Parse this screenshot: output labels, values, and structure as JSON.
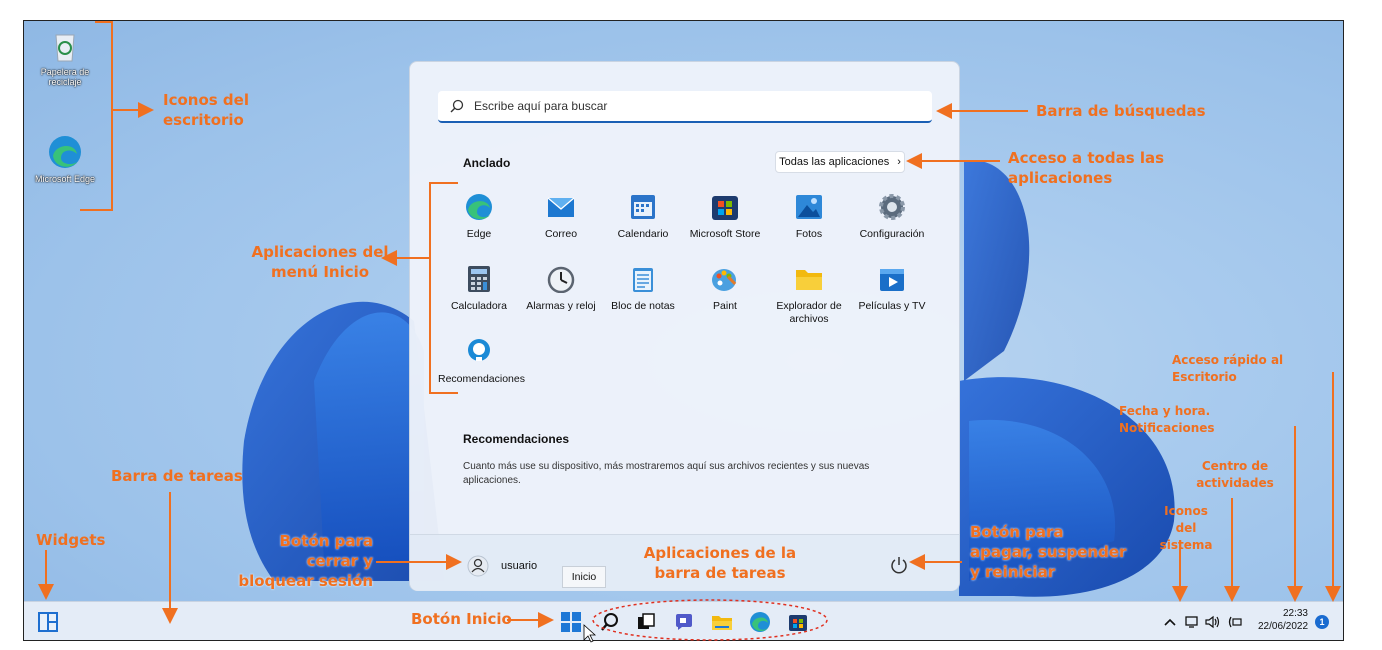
{
  "desktop": {
    "icons": [
      {
        "label": "Papelera de reciclaje",
        "icon": "recycle-bin-icon"
      },
      {
        "label": "Microsoft Edge",
        "icon": "edge-icon"
      }
    ]
  },
  "start_menu": {
    "search_placeholder": "Escribe aquí para buscar",
    "pinned_title": "Anclado",
    "all_apps_label": "Todas las aplicaciones",
    "apps": [
      {
        "label": "Edge",
        "icon": "edge-icon",
        "color": "#1f8fd6"
      },
      {
        "label": "Correo",
        "icon": "mail-icon",
        "color": "#1d78d0"
      },
      {
        "label": "Calendario",
        "icon": "calendar-icon",
        "color": "#2b74c9"
      },
      {
        "label": "Microsoft Store",
        "icon": "store-icon",
        "color": "#1d3b6e"
      },
      {
        "label": "Fotos",
        "icon": "photos-icon",
        "color": "#2e88d8"
      },
      {
        "label": "Configuración",
        "icon": "gear-icon",
        "color": "#5b6b7d"
      },
      {
        "label": "Calculadora",
        "icon": "calculator-icon",
        "color": "#3d4c5e"
      },
      {
        "label": "Alarmas y reloj",
        "icon": "clock-icon",
        "color": "#5b6470"
      },
      {
        "label": "Bloc de notas",
        "icon": "notepad-icon",
        "color": "#3a8fd8"
      },
      {
        "label": "Paint",
        "icon": "paint-icon",
        "color": "#4aa0e0"
      },
      {
        "label": "Explorador de archivos",
        "icon": "folder-icon",
        "color": "#f2b90f"
      },
      {
        "label": "Películas y TV",
        "icon": "movies-icon",
        "color": "#1a6fc8"
      },
      {
        "label": "Recomendaciones",
        "icon": "tips-icon",
        "color": "#1b8ad6"
      }
    ],
    "recommendations_title": "Recomendaciones",
    "recommendations_text": "Cuanto más use su dispositivo, más mostraremos aquí sus archivos recientes y sus nuevas aplicaciones.",
    "user_name": "usuario"
  },
  "tooltip": "Inicio",
  "taskbar": {
    "time": "22:33",
    "date": "22/06/2022",
    "notifications": "1"
  },
  "annotations": {
    "desktop_icons": "Iconos del escritorio",
    "search_bar": "Barra de búsquedas",
    "all_apps": "Acceso a todas las aplicaciones",
    "menu_apps": "Aplicaciones del menú Inicio",
    "show_desktop": "Acceso rápido al Escritorio",
    "datetime": "Fecha y hora. Notificaciones",
    "action_center": "Centro de actividades",
    "system_icons": "Iconos del sistema",
    "taskbar": "Barra de tareas",
    "widgets": "Widgets",
    "lock_button": "Botón para cerrar y bloquear sesión",
    "taskbar_apps": "Aplicaciones de la barra de tareas",
    "power_button": "Botón para apagar, suspender y reiniciar",
    "start_button": "Botón Inicio"
  },
  "colors": {
    "annotation": "#f07020",
    "accent": "#1a5fb4"
  }
}
